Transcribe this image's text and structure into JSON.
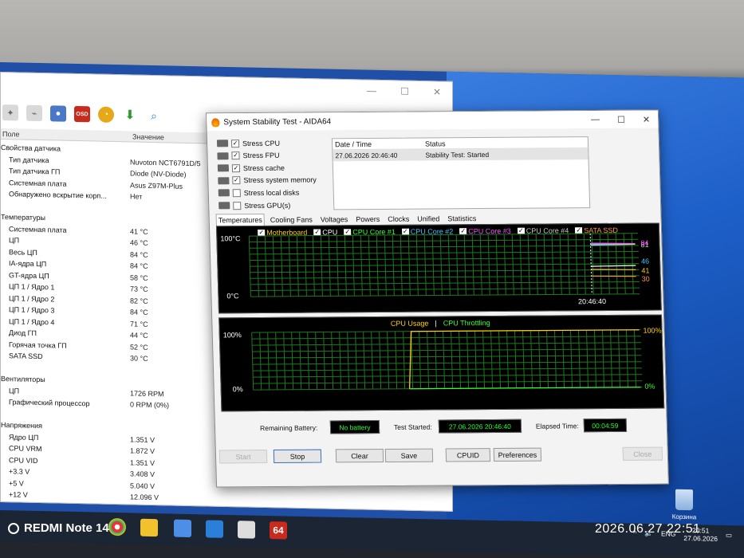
{
  "background_window": {
    "columns": {
      "field": "Поле",
      "value": "Значение"
    },
    "rows": [
      {
        "name": "Свойства датчика",
        "value": "",
        "section": true
      },
      {
        "name": "Тип датчика",
        "value": "Nuvoton NCT6791D/5"
      },
      {
        "name": "Тип датчика ГП",
        "value": "Diode  (NV-Diode)"
      },
      {
        "name": "Системная плата",
        "value": "Asus Z97M-Plus"
      },
      {
        "name": "Обнаружено вскрытие корп...",
        "value": "Нет"
      },
      {
        "name": "",
        "value": "",
        "section": true
      },
      {
        "name": "Температуры",
        "value": "",
        "section": true
      },
      {
        "name": "Системная плата",
        "value": "41 °C"
      },
      {
        "name": "ЦП",
        "value": "46 °C"
      },
      {
        "name": "Весь ЦП",
        "value": "84 °C"
      },
      {
        "name": "IA-ядра ЦП",
        "value": "84 °C"
      },
      {
        "name": "GT-ядра ЦП",
        "value": "58 °C"
      },
      {
        "name": "ЦП 1 / Ядро 1",
        "value": "73 °C"
      },
      {
        "name": "ЦП 1 / Ядро 2",
        "value": "82 °C"
      },
      {
        "name": "ЦП 1 / Ядро 3",
        "value": "84 °C"
      },
      {
        "name": "ЦП 1 / Ядро 4",
        "value": "71 °C"
      },
      {
        "name": "Диод ГП",
        "value": "44 °C"
      },
      {
        "name": "Горячая точка ГП",
        "value": "52 °C"
      },
      {
        "name": "SATA SSD",
        "value": "30 °C"
      },
      {
        "name": "",
        "value": "",
        "section": true
      },
      {
        "name": "Вентиляторы",
        "value": "",
        "section": true
      },
      {
        "name": "ЦП",
        "value": "1726 RPM"
      },
      {
        "name": "Графический процессор",
        "value": "0 RPM  (0%)"
      },
      {
        "name": "",
        "value": "",
        "section": true
      },
      {
        "name": "Напряжения",
        "value": "",
        "section": true
      },
      {
        "name": "Ядро ЦП",
        "value": "1.351 V"
      },
      {
        "name": "CPU VRM",
        "value": "1.872 V"
      },
      {
        "name": "CPU VID",
        "value": "1.351 V"
      },
      {
        "name": "+3.3 V",
        "value": "3.408 V"
      },
      {
        "name": "+5 V",
        "value": "5.040 V"
      },
      {
        "name": "+12 V",
        "value": "12.096 V"
      }
    ],
    "toolbar_label": "OSD"
  },
  "aida": {
    "title": "System Stability Test - AIDA64",
    "stress": [
      {
        "label": "Stress CPU",
        "checked": true
      },
      {
        "label": "Stress FPU",
        "checked": true
      },
      {
        "label": "Stress cache",
        "checked": true
      },
      {
        "label": "Stress system memory",
        "checked": true
      },
      {
        "label": "Stress local disks",
        "checked": false
      },
      {
        "label": "Stress GPU(s)",
        "checked": false
      }
    ],
    "log": {
      "col_date": "Date / Time",
      "col_status": "Status",
      "rows": [
        {
          "date": "27.06.2026 20:46:40",
          "status": "Stability Test: Started"
        }
      ]
    },
    "tabs": [
      "Temperatures",
      "Cooling Fans",
      "Voltages",
      "Powers",
      "Clocks",
      "Unified",
      "Statistics"
    ],
    "temp_legend": [
      {
        "label": "Motherboard",
        "color": "#ffd200"
      },
      {
        "label": "CPU",
        "color": "#ffffff"
      },
      {
        "label": "CPU Core #1",
        "color": "#39ff39"
      },
      {
        "label": "CPU Core #2",
        "color": "#3fc8ff"
      },
      {
        "label": "CPU Core #3",
        "color": "#ff4dff"
      },
      {
        "label": "CPU Core #4",
        "color": "#c8c8c8"
      },
      {
        "label": "SATA SSD",
        "color": "#ff9b3d"
      }
    ],
    "temp_ymax_label": "100°C",
    "temp_ymin_label": "0°C",
    "temp_time_label": "20:46:40",
    "temp_right_values": [
      "81",
      "84",
      "41",
      "46",
      "30"
    ],
    "usage_legend": [
      {
        "label": "CPU Usage",
        "color": "#ffd200"
      },
      {
        "label": "|",
        "color": "#ffffff"
      },
      {
        "label": "CPU Throttling",
        "color": "#39ff39"
      }
    ],
    "usage_ymax_label": "100%",
    "usage_ymin_label": "0%",
    "usage_right_max": "100%",
    "usage_right_min": "0%",
    "remaining_battery_label": "Remaining Battery:",
    "remaining_battery_value": "No battery",
    "test_started_label": "Test Started:",
    "test_started_value": "27.06.2026 20:46:40",
    "elapsed_label": "Elapsed Time:",
    "elapsed_value": "00:04:59",
    "buttons": {
      "start": "Start",
      "stop": "Stop",
      "clear": "Clear",
      "save": "Save",
      "cpuid": "CPUID",
      "preferences": "Preferences",
      "close": "Close"
    }
  },
  "chart_data": [
    {
      "type": "line",
      "title": "",
      "ylim": [
        0,
        100
      ],
      "ylabel": "°C",
      "x": [
        "20:46:40"
      ],
      "series": [
        {
          "name": "Motherboard",
          "color": "#ffd200",
          "values": [
            41
          ]
        },
        {
          "name": "CPU",
          "color": "#ffffff",
          "values": [
            46
          ]
        },
        {
          "name": "CPU Core #1",
          "color": "#39ff39",
          "values": [
            84
          ]
        },
        {
          "name": "CPU Core #2",
          "color": "#3fc8ff",
          "values": [
            82
          ]
        },
        {
          "name": "CPU Core #3",
          "color": "#ff4dff",
          "values": [
            84
          ]
        },
        {
          "name": "CPU Core #4",
          "color": "#c8c8c8",
          "values": [
            81
          ]
        },
        {
          "name": "SATA SSD",
          "color": "#ff9b3d",
          "values": [
            30
          ]
        }
      ]
    },
    {
      "type": "line",
      "title": "",
      "ylim": [
        0,
        100
      ],
      "series": [
        {
          "name": "CPU Usage",
          "color": "#ffd200",
          "values": [
            0,
            100,
            100
          ]
        },
        {
          "name": "CPU Throttling",
          "color": "#39ff39",
          "values": [
            0,
            0,
            0
          ]
        }
      ]
    }
  ],
  "desktop": {
    "recycle_bin": "Корзина",
    "tray_lang": "ENG",
    "tray_time": "20:51",
    "tray_date": "27.06.2026",
    "taskbar_aida_label": "64"
  },
  "photo_overlay": {
    "device": "REDMI Note 14",
    "timestamp": "2026.06.27  22:51"
  }
}
